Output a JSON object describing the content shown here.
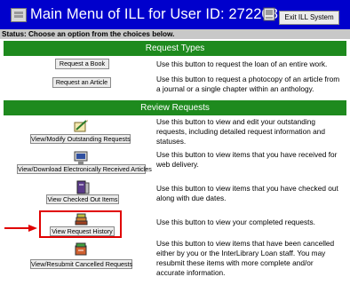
{
  "header": {
    "title": "Main Menu of ILL for User ID: 272203",
    "exit_label": "Exit ILL System",
    "bg_color": "#0000cc"
  },
  "status": {
    "text": "Status: Choose an option from the choices below."
  },
  "request_types": {
    "heading": "Request Types",
    "items": [
      {
        "button": "Request a Book",
        "description": "Use this button to request the loan of an entire work."
      },
      {
        "button": "Request an Article",
        "description": "Use this button to request a photocopy of an article from a journal or a single chapter within an anthology."
      }
    ]
  },
  "review_requests": {
    "heading": "Review Requests",
    "items": [
      {
        "button": "View/Modify Outstanding Requests",
        "icon": "pencil-document-icon",
        "description": "Use this button to view and edit your outstanding requests, including detailed request information and statuses."
      },
      {
        "button": "View/Download Electronically Received Articles",
        "icon": "computer-monitor-icon",
        "description": "Use this button to view items that you have received for web delivery."
      },
      {
        "button": "View Checked Out Items",
        "icon": "book-checkout-icon",
        "description": "Use this button to view items that you have checked out along with due dates."
      },
      {
        "button": "View Request History",
        "icon": "book-stack-icon",
        "description": "Use this button to view your completed requests."
      },
      {
        "button": "View/Resubmit Cancelled Requests",
        "icon": "resubmit-icon",
        "description": "Use this button to view items that have been cancelled either by you or the InterLibrary Loan staff. You may resubmit these items with more complete and/or accurate information."
      }
    ]
  },
  "colors": {
    "section_green": "#1e8a1e",
    "highlight_red": "#e00000",
    "status_gray": "#c8c8c8"
  }
}
